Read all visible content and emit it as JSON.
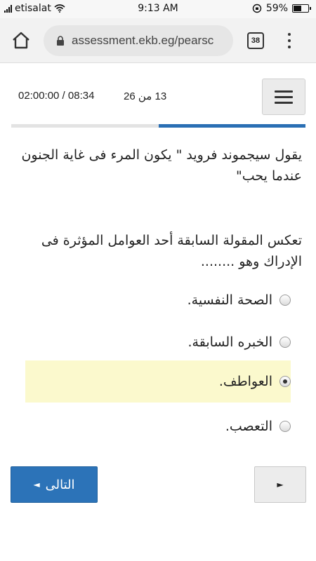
{
  "status_bar": {
    "carrier": "etisalat",
    "time": "9:13 AM",
    "battery": "59%",
    "battery_level": 0.59
  },
  "browser": {
    "url": "assessment.ekb.eg/pearsc",
    "tab_count": "38",
    "icons": [
      "home-icon",
      "lock-icon",
      "tabs-icon",
      "overflow-menu-icon"
    ]
  },
  "assessment": {
    "timer": "02:00:00 / 08:34",
    "counter": "13 من 26",
    "progress": 0.5
  },
  "question": {
    "quote": "يقول سيجموند فرويد \" يكون المرء فى غاية الجنون عندما يحب\"",
    "prompt": "تعكس المقولة السابقة أحد العوامل المؤثرة فى الإدراك وهو ........",
    "options": [
      {
        "label": "الصحة النفسية.",
        "selected": false
      },
      {
        "label": "الخبره السابقة.",
        "selected": false
      },
      {
        "label": "العواطف.",
        "selected": true
      },
      {
        "label": "التعصب.",
        "selected": false
      }
    ]
  },
  "navigation": {
    "next_label": "التالى",
    "next_arrow": "◄",
    "play_arrow": "►"
  },
  "colors": {
    "accent": "#2c73b8",
    "selected_bg": "#fbf9cd",
    "progress_track": "#e3e3e3"
  }
}
